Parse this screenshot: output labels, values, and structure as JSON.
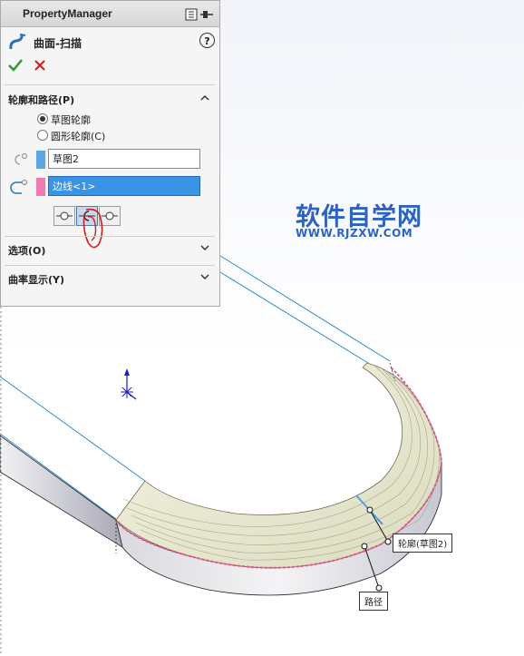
{
  "panel": {
    "title": "PropertyManager",
    "feature_name": "曲面-扫描",
    "help": "?",
    "ok": "ok",
    "cancel": "cancel"
  },
  "profile_path": {
    "header": "轮廓和路径(P)",
    "radio_sketch_profile": "草图轮廓",
    "radio_circular_profile": "圆形轮廓(C)",
    "selected_option": "草图轮廓",
    "profile_value": "草图2",
    "path_value": "边线<1>"
  },
  "options": {
    "header": "选项(O)"
  },
  "curvature": {
    "header": "曲率显示(Y)"
  },
  "watermark": {
    "cn": "软件自学网",
    "en": "WWW.RJZXW.COM"
  },
  "callouts": {
    "profile": "轮廓(草图2)",
    "path": "路径"
  },
  "colors": {
    "accent_blue": "#3a94e6",
    "profile_swatch": "#5aa6e8",
    "path_swatch": "#f07ab0",
    "watermark": "#2a62c8",
    "ok_green": "#2e9a2e",
    "cancel_red": "#d22020",
    "path_highlight": "#e8558f"
  }
}
